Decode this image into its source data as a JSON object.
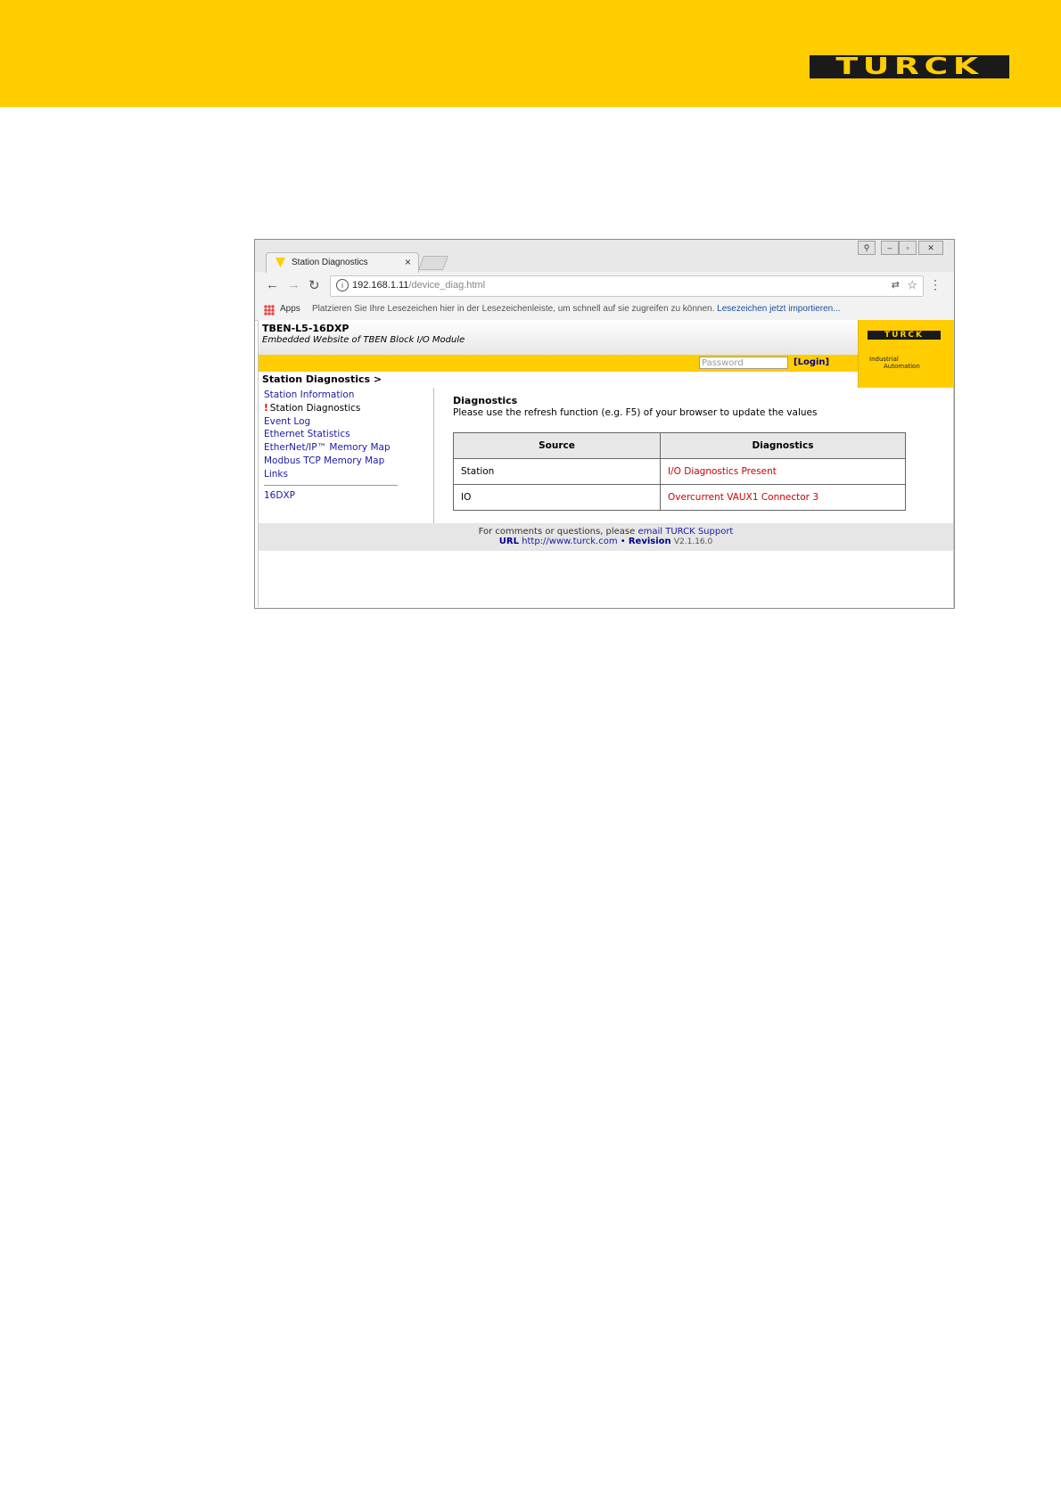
{
  "banner": {
    "brand": "TURCK"
  },
  "browser": {
    "tab_title": "Station Diagnostics",
    "tab_close": "×",
    "url_host": "192.168.1.11",
    "url_path": "/device_diag.html",
    "bookmarks": {
      "apps": "Apps",
      "hint": "Platzieren Sie Ihre Lesezeichen hier in der Lesezeichenleiste, um schnell auf sie zugreifen zu können.",
      "import_link": "Lesezeichen jetzt importieren..."
    },
    "icons": [
      "back-icon",
      "forward-icon",
      "reload-icon",
      "info-icon",
      "translate-icon",
      "star-icon",
      "menu-icon",
      "user-icon",
      "minimize-icon",
      "maximize-icon",
      "close-icon"
    ]
  },
  "page": {
    "device": "TBEN-L5-16DXP",
    "subtitle": "Embedded Website of TBEN Block I/O Module",
    "password_placeholder": "Password",
    "login": "[Login]",
    "logo": {
      "wordmark": "TURCK",
      "line1": "Industrial",
      "line2": "Automation"
    },
    "breadcrumb": "Station Diagnostics >",
    "nav": [
      {
        "label": "Station Information"
      },
      {
        "label": "Station Diagnostics",
        "marker": "!"
      },
      {
        "label": "Event Log"
      },
      {
        "label": "Ethernet Statistics"
      },
      {
        "label": "EtherNet/IP™ Memory Map"
      },
      {
        "label": "Modbus TCP Memory Map"
      },
      {
        "label": "Links"
      },
      {
        "label": "16DXP"
      }
    ],
    "diagnostics": {
      "title": "Diagnostics",
      "hint": "Please use the refresh function (e.g. F5) of your browser to update the values",
      "headers": [
        "Source",
        "Diagnostics"
      ],
      "rows": [
        {
          "source": "Station",
          "value": "I/O Diagnostics Present"
        },
        {
          "source": "IO",
          "value": "Overcurrent VAUX1 Connector 3"
        }
      ]
    },
    "footer": {
      "line1_text": "For comments or questions, please",
      "line1_link": "email TURCK Support",
      "url_label": "URL",
      "url_link": "http://www.turck.com",
      "sep": "•",
      "revision_label": "Revision",
      "revision": "V2.1.16.0"
    }
  },
  "colors": {
    "accent": "#ffcd00",
    "link": "#1a1aa6",
    "error": "#d00000"
  }
}
